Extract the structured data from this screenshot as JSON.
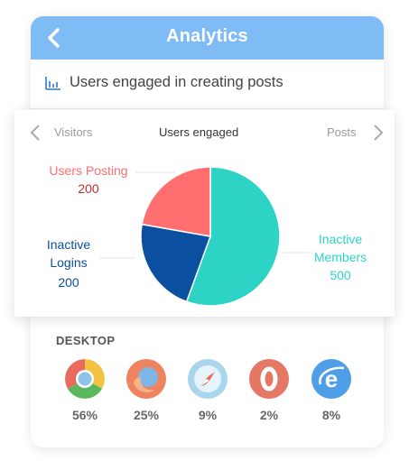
{
  "header": {
    "title": "Analytics"
  },
  "subhead": {
    "label": "Users engaged in creating posts"
  },
  "chart_nav": {
    "prev": "Visitors",
    "current": "Users engaged",
    "next": "Posts"
  },
  "chart_data": {
    "type": "pie",
    "slices": [
      {
        "label": "Inactive Members",
        "value": 500,
        "color": "#2dd4c6"
      },
      {
        "label": "Inactive Logins",
        "value": 200,
        "color": "#0a4fa0"
      },
      {
        "label": "Users Posting",
        "value": 200,
        "color": "#ff6f70"
      }
    ],
    "labels": {
      "posting": {
        "name": "Users Posting",
        "value": "200",
        "color": "#ff6f70"
      },
      "logins": {
        "line1": "Inactive",
        "line2": "Logins",
        "value": "200",
        "color": "#0a4fa0"
      },
      "members": {
        "line1": "Inactive",
        "line2": "Members",
        "value": "500",
        "color": "#2dd4c6"
      }
    }
  },
  "desktop": {
    "title": "DESKTOP",
    "browsers": [
      {
        "icon": "chrome-icon",
        "percent": "56%"
      },
      {
        "icon": "firefox-icon",
        "percent": "25%"
      },
      {
        "icon": "safari-icon",
        "percent": "9%"
      },
      {
        "icon": "opera-icon",
        "percent": "2%"
      },
      {
        "icon": "ie-icon",
        "percent": "8%"
      }
    ]
  }
}
